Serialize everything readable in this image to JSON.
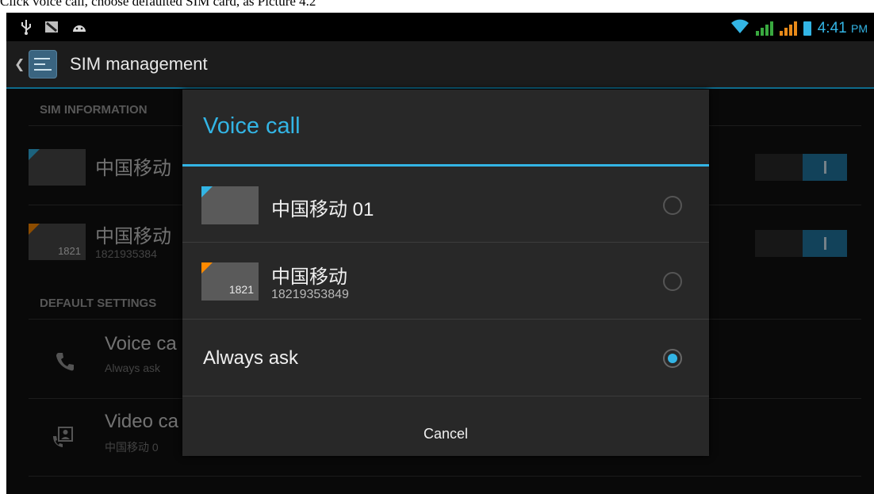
{
  "caption": "Click voice call, choose defaulted SIM card, as Picture 4.2",
  "status_bar": {
    "time": "4:41",
    "ampm": "PM",
    "icons_left": [
      "usb-icon",
      "screenshot-icon",
      "android-icon"
    ],
    "icons_right": [
      "wifi-icon",
      "signal-sim1-icon",
      "signal-sim2-icon",
      "battery-icon"
    ],
    "colors": {
      "accent": "#33b5e5",
      "signal": "#39a93f"
    }
  },
  "action_bar": {
    "title": "SIM management"
  },
  "background_list": {
    "sim_info_header": "SIM INFORMATION",
    "sim1": {
      "name": "中国移动"
    },
    "sim2": {
      "name": "中国移动",
      "thumb_number": "1821",
      "number": "1821935384"
    },
    "default_settings_header": "DEFAULT SETTINGS",
    "voice_call": {
      "title": "Voice ca",
      "subtitle": "Always ask"
    },
    "video_call": {
      "title": "Video ca",
      "subtitle": "中国移动 0"
    }
  },
  "dialog": {
    "title": "Voice call",
    "options": [
      {
        "label": "中国移动 01",
        "subtitle": "",
        "thumb_number": "",
        "corner_color": "#33b5e5",
        "selected": false
      },
      {
        "label": "中国移动",
        "subtitle": "18219353849",
        "thumb_number": "1821",
        "corner_color": "#ff8a00",
        "selected": false
      },
      {
        "label": "Always ask",
        "subtitle": "",
        "thumb_number": "",
        "corner_color": "",
        "selected": true
      }
    ],
    "cancel_label": "Cancel"
  }
}
